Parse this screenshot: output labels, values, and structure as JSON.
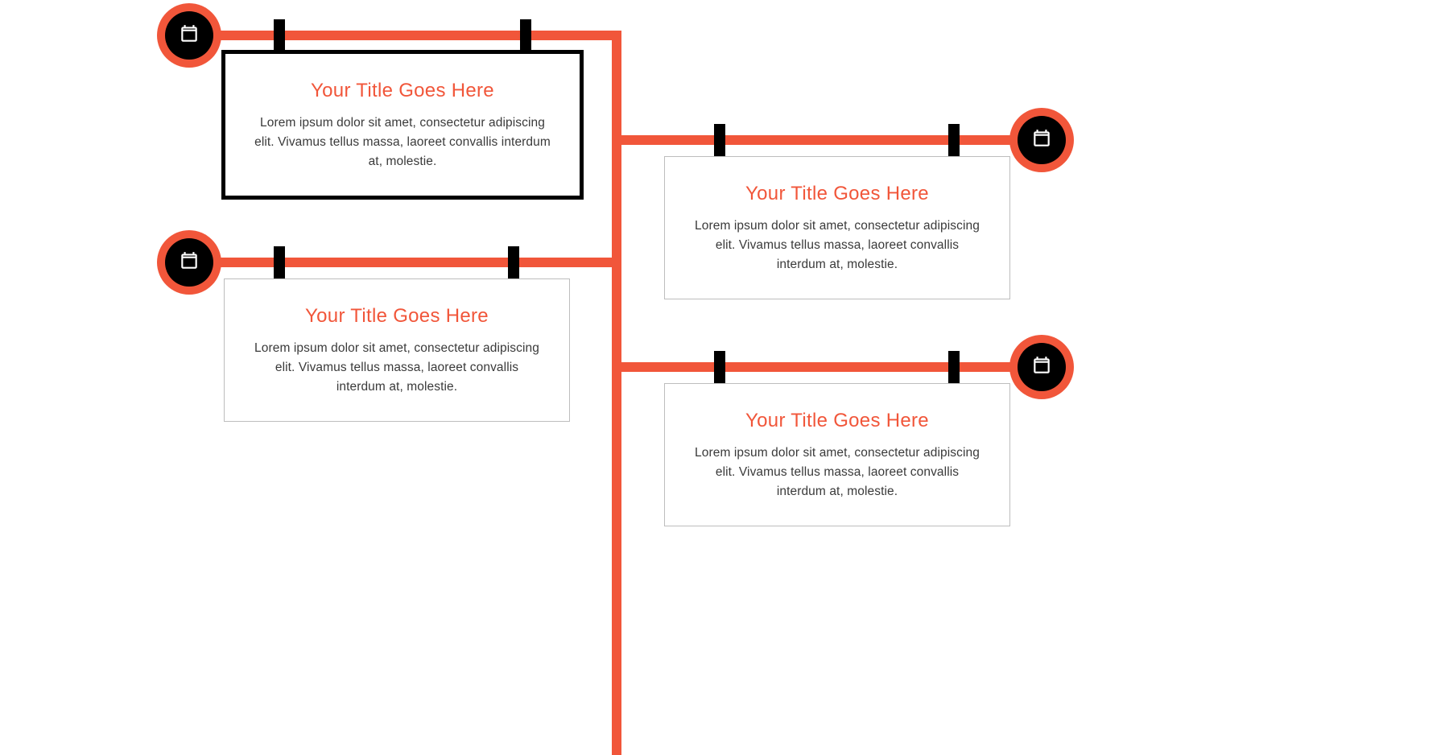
{
  "colors": {
    "accent": "#f1563a",
    "ink": "#000000",
    "text": "#3a3a3a"
  },
  "items": [
    {
      "side": "left",
      "title": "Your Title Goes Here",
      "desc": "Lorem ipsum dolor sit amet, consectetur adipiscing elit. Vivamus tellus massa, laoreet convallis interdum at, molestie.",
      "highlighted": true
    },
    {
      "side": "right",
      "title": "Your Title Goes Here",
      "desc": "Lorem ipsum dolor sit amet, consectetur adipiscing elit. Vivamus tellus massa, laoreet convallis interdum at, molestie.",
      "highlighted": false
    },
    {
      "side": "left",
      "title": "Your Title Goes Here",
      "desc": "Lorem ipsum dolor sit amet, consectetur adipiscing elit. Vivamus tellus massa, laoreet convallis interdum at, molestie.",
      "highlighted": false
    },
    {
      "side": "right",
      "title": "Your Title Goes Here",
      "desc": "Lorem ipsum dolor sit amet, consectetur adipiscing elit. Vivamus tellus massa, laoreet convallis interdum at, molestie.",
      "highlighted": false
    }
  ]
}
